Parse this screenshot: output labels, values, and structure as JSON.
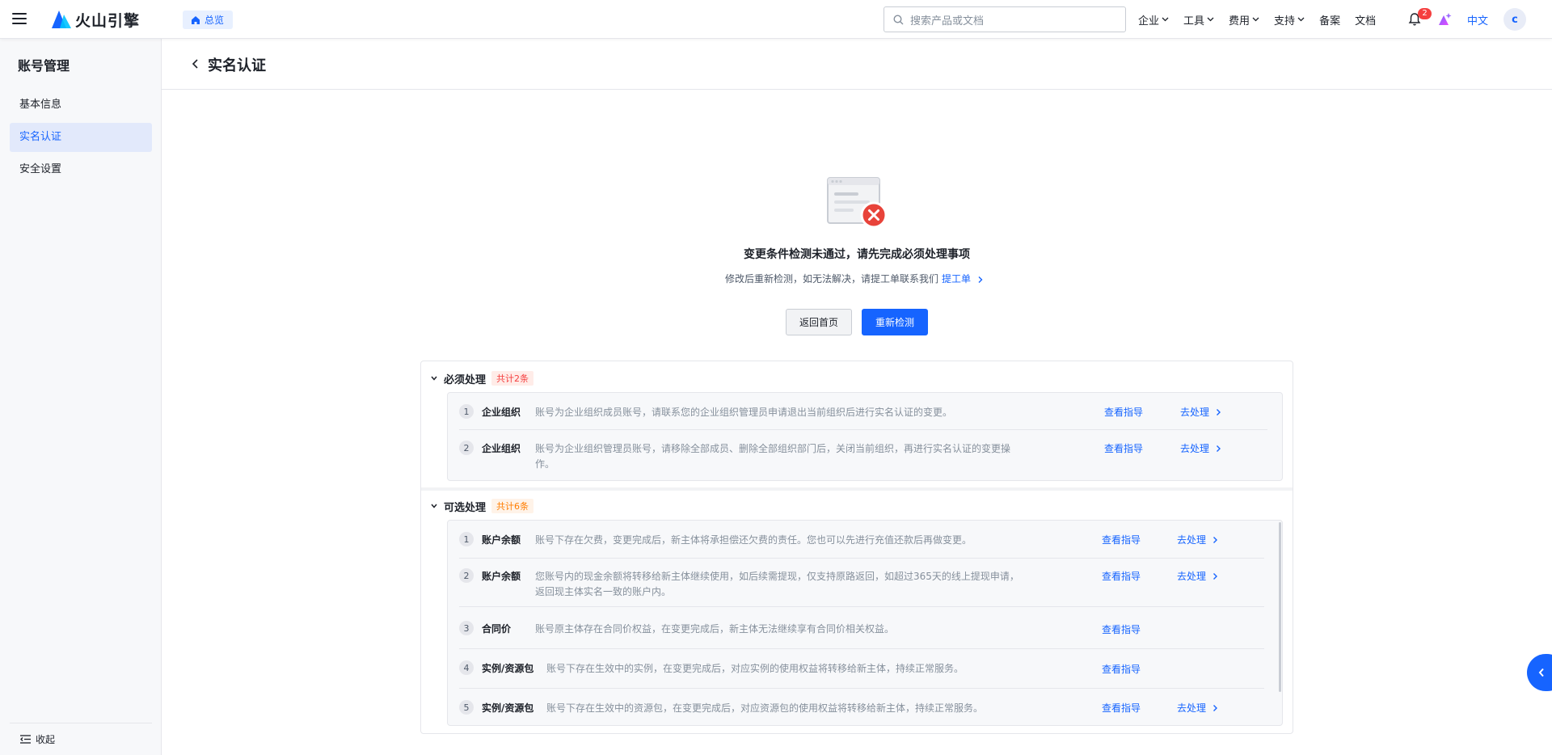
{
  "topbar": {
    "brand": "火山引擎",
    "overview_tag": "总览",
    "search_placeholder": "搜索产品或文档",
    "nav": [
      "企业",
      "工具",
      "费用",
      "支持",
      "备案",
      "文档"
    ],
    "notification_count": "2",
    "language": "中文",
    "avatar_initial": "c",
    "accent_color": "#1664ff"
  },
  "sidebar": {
    "title": "账号管理",
    "items": [
      {
        "label": "基本信息",
        "active": false
      },
      {
        "label": "实名认证",
        "active": true
      },
      {
        "label": "安全设置",
        "active": false
      }
    ],
    "collapse_label": "收起"
  },
  "page": {
    "title": "实名认证"
  },
  "result": {
    "title": "变更条件检测未通过，请先完成必须处理事项",
    "desc": "修改后重新检测，如无法解决，请提工单联系我们",
    "ticket_link": "提工单",
    "back_home": "返回首页",
    "recheck": "重新检测"
  },
  "required": {
    "title": "必须处理",
    "count": "共计2条",
    "items": [
      {
        "num": "1",
        "type": "企业组织",
        "desc": "账号为企业组织成员账号，请联系您的企业组织管理员申请退出当前组织后进行实名认证的变更。",
        "guide": "查看指导",
        "handle": "去处理"
      },
      {
        "num": "2",
        "type": "企业组织",
        "desc": "账号为企业组织管理员账号，请移除全部成员、删除全部组织部门后，关闭当前组织，再进行实名认证的变更操作。",
        "guide": "查看指导",
        "handle": "去处理"
      }
    ]
  },
  "optional": {
    "title": "可选处理",
    "count": "共计6条",
    "items": [
      {
        "num": "1",
        "type": "账户余额",
        "desc": "账号下存在欠费，变更完成后，新主体将承担偿还欠费的责任。您也可以先进行充值还款后再做变更。",
        "guide": "查看指导",
        "handle": "去处理"
      },
      {
        "num": "2",
        "type": "账户余额",
        "desc": "您账号内的现金余额将转移给新主体继续使用，如后续需提现，仅支持原路返回，如超过365天的线上提现申请，返回现主体实名一致的账户内。",
        "guide": "查看指导",
        "handle": "去处理"
      },
      {
        "num": "3",
        "type": "合同价",
        "desc": "账号原主体存在合同价权益，在变更完成后，新主体无法继续享有合同价相关权益。",
        "guide": "查看指导",
        "handle": ""
      },
      {
        "num": "4",
        "type": "实例/资源包",
        "desc": "账号下存在生效中的实例，在变更完成后，对应实例的使用权益将转移给新主体，持续正常服务。",
        "guide": "查看指导",
        "handle": ""
      },
      {
        "num": "5",
        "type": "实例/资源包",
        "desc": "账号下存在生效中的资源包，在变更完成后，对应资源包的使用权益将转移给新主体，持续正常服务。",
        "guide": "查看指导",
        "handle": "去处理"
      }
    ]
  }
}
